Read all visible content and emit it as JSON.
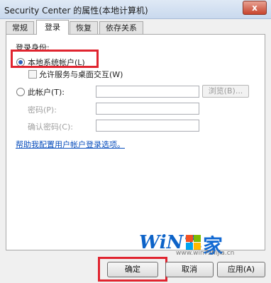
{
  "window": {
    "title": "Security Center 的属性(本地计算机)",
    "close_glyph": "x"
  },
  "tabs": [
    {
      "label": "常规",
      "active": false
    },
    {
      "label": "登录",
      "active": true
    },
    {
      "label": "恢复",
      "active": false
    },
    {
      "label": "依存关系",
      "active": false
    }
  ],
  "logon": {
    "section_label": "登录身份:",
    "local_system_account": {
      "label": "本地系统帐户(L)",
      "selected": true
    },
    "allow_desktop": {
      "label": "允许服务与桌面交互(W)",
      "checked": false
    },
    "this_account": {
      "label": "此帐户(T):",
      "selected": false,
      "value": ""
    },
    "browse_label": "浏览(B)...",
    "password_label": "密码(P):",
    "confirm_password_label": "确认密码(C):",
    "help_link": "帮助我配置用户帐户登录选项。"
  },
  "watermark": {
    "logo": "WiN7.",
    "char": "家",
    "url": "www.win7zhijia.cn"
  },
  "buttons": {
    "ok": "确定",
    "cancel": "取消",
    "apply": "应用(A)"
  }
}
